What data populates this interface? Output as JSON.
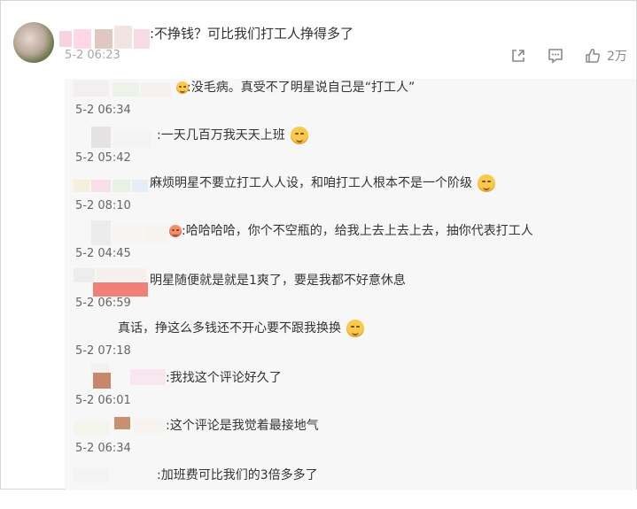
{
  "main_comment": {
    "text": ":不挣钱？可比我们打工人挣得多了",
    "time": "5-2 06:23",
    "actions": {
      "share_icon": "share-icon",
      "comment_icon": "comment-icon",
      "like_icon": "thumbs-up-icon",
      "like_count": "2万"
    }
  },
  "replies": [
    {
      "text": ":没毛病。真受不了明星说自己是“打工人”",
      "time": "5-2 06:34",
      "emoji": "smile-icon-leading"
    },
    {
      "text": ":一天几百万我天天上班",
      "time": "5-2 05:42",
      "emoji": "smile-icon"
    },
    {
      "text": "麻烦明星不要立打工人人设，和咱打工人根本不是一个阶级",
      "time": "5-2 08:10",
      "emoji": "thinking-icon"
    },
    {
      "text": ":哈哈哈哈，你个不空瓶的，给我上去上去上去，抽你代表打工人",
      "time": "5-2 04:45",
      "emoji": "laugh-icon-leading"
    },
    {
      "text": "明星随便就是就是1爽了，要是我都不好意休息",
      "time": "5-2 06:59",
      "emoji": ""
    },
    {
      "text": "真话，挣这么多钱还不开心要不跟我换换",
      "time": "5-2 07:18",
      "emoji": "grin-icon"
    },
    {
      "text": ":我找这个评论好久了",
      "time": "5-2 06:01",
      "emoji": ""
    },
    {
      "text": ":这个评论是我觉着最接地气",
      "time": "5-2 06:34",
      "emoji": ""
    },
    {
      "text": ":加班费可比我们的3倍多多了",
      "time": "",
      "emoji": ""
    }
  ]
}
